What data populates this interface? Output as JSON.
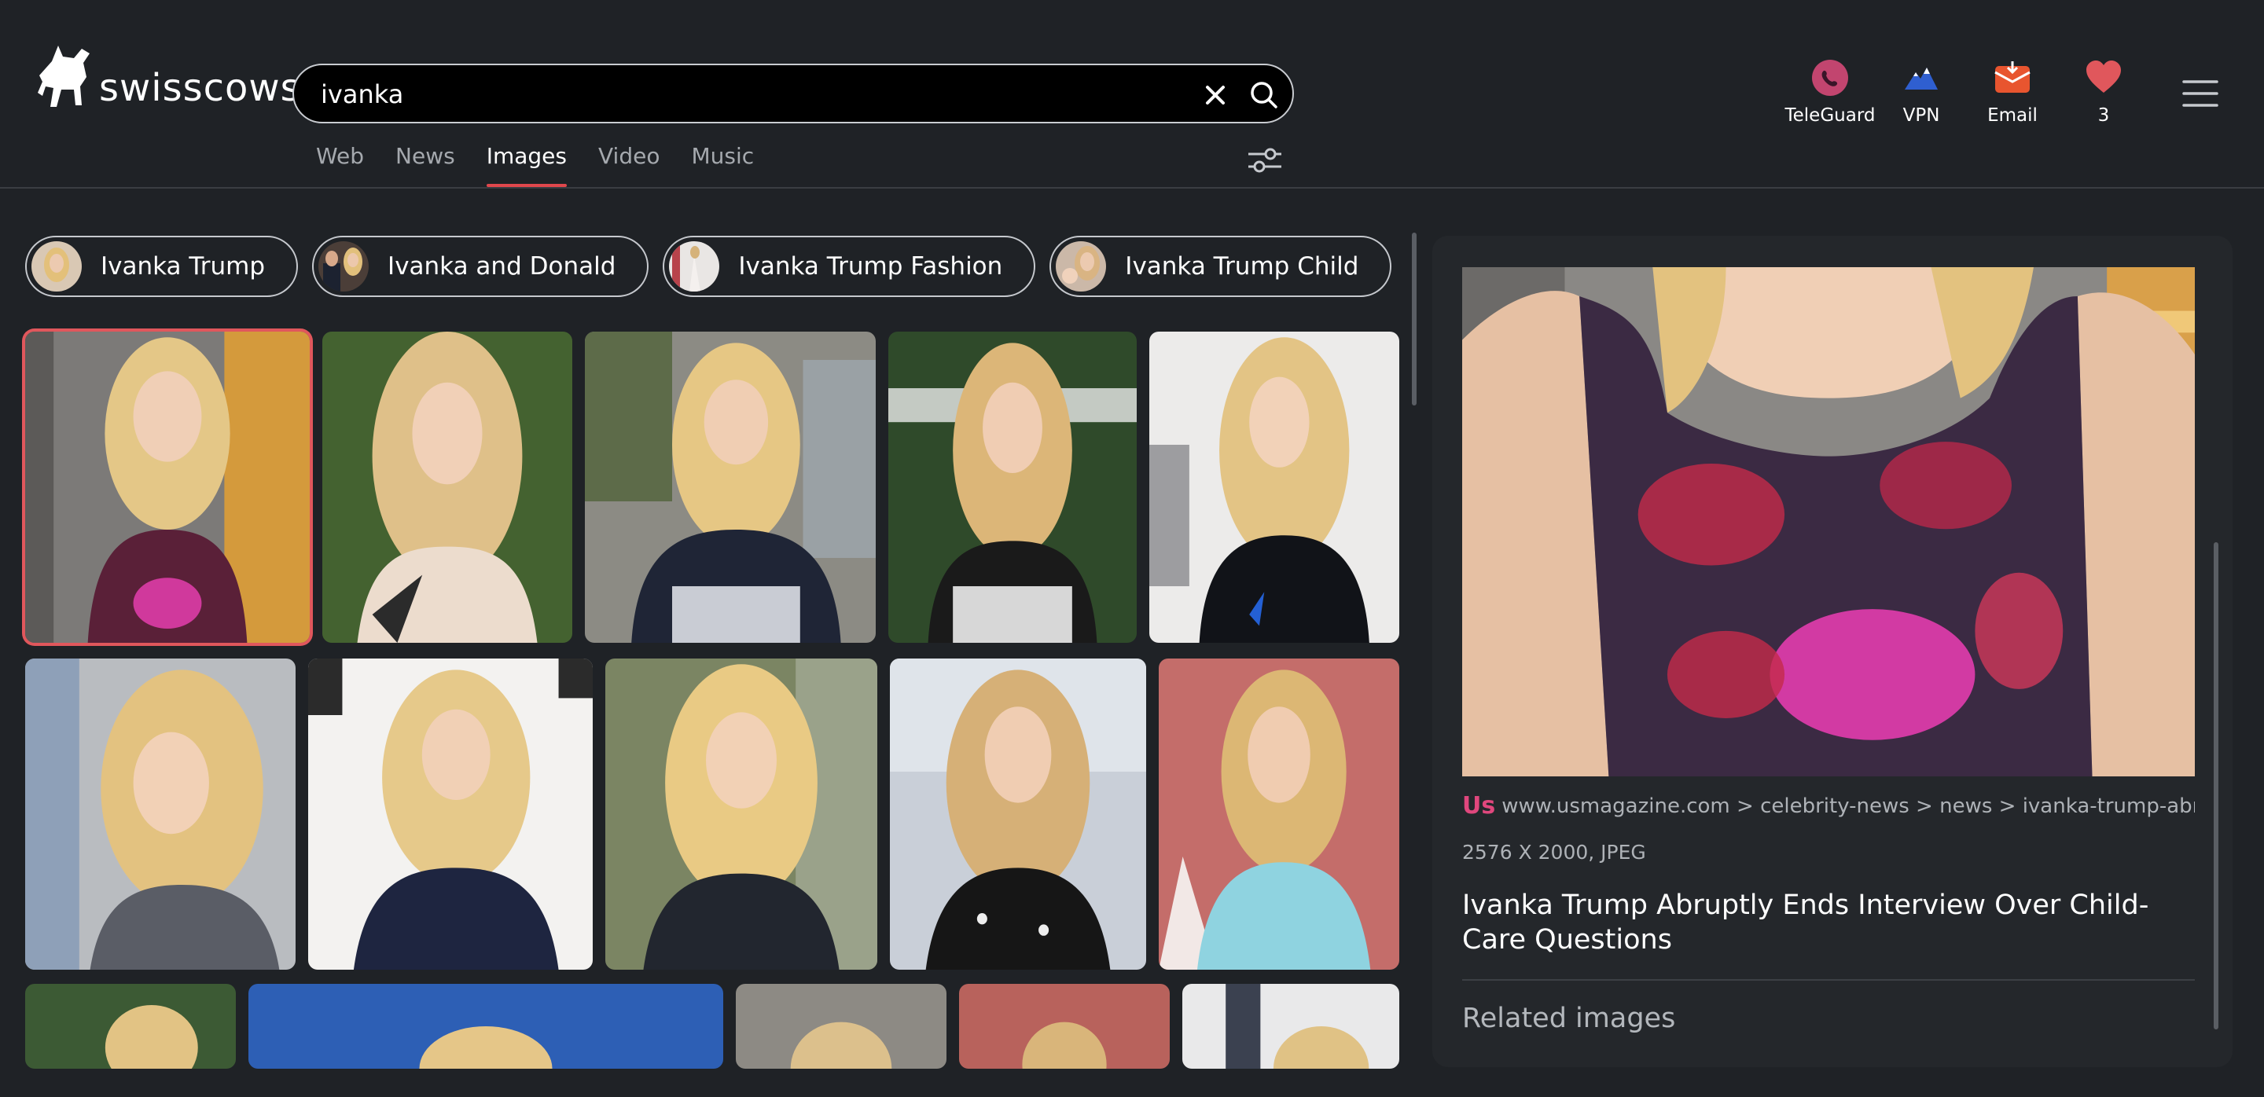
{
  "brand": {
    "name": "swisscows"
  },
  "search": {
    "value": "ivanka",
    "clear_icon": "close-icon",
    "submit_icon": "search-icon"
  },
  "tabs": [
    {
      "label": "Web",
      "active": false
    },
    {
      "label": "News",
      "active": false
    },
    {
      "label": "Images",
      "active": true
    },
    {
      "label": "Video",
      "active": false
    },
    {
      "label": "Music",
      "active": false
    }
  ],
  "actions": [
    {
      "label": "TeleGuard",
      "icon": "teleguard-icon"
    },
    {
      "label": "VPN",
      "icon": "vpn-icon"
    },
    {
      "label": "Email",
      "icon": "email-icon"
    },
    {
      "label": "3",
      "icon": "heart-icon"
    }
  ],
  "chips": [
    {
      "label": "Ivanka Trump"
    },
    {
      "label": "Ivanka and Donald"
    },
    {
      "label": "Ivanka Trump Fashion"
    },
    {
      "label": "Ivanka Trump Child"
    }
  ],
  "preview": {
    "source": "www.usmagazine.com > celebrity-news > news > ivanka-trump-abru...",
    "source_logo": "Us",
    "dimensions": "2576 X 2000, JPEG",
    "title": "Ivanka Trump Abruptly Ends Interview Over Child-Care Questions",
    "related_label": "Related images"
  },
  "colors": {
    "accent": "#e0474c",
    "background": "#1f2226",
    "panel": "#24272b",
    "favorite": "#e0575c"
  }
}
